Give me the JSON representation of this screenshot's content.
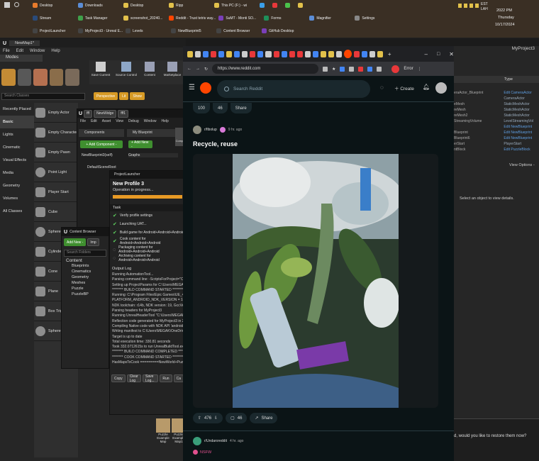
{
  "taskbar": {
    "row1": [
      "Desktop",
      "Downloads",
      "Desktop",
      "Ripp",
      "This PC (F:) - wi",
      "",
      "",
      "",
      ""
    ],
    "row2": [
      "Stream",
      "Task Manager",
      "screenshot_20240...",
      "Reddit - Trust tetris way...",
      "SuMT - Monti SO...",
      "Forms",
      "Magnifier",
      "Settings"
    ],
    "row3": [
      "ProjectLauncher",
      "MyProject3 - Unreal E...",
      "Levels",
      "NewBlueprint5",
      "Content Browser",
      "GitHub Desktop"
    ],
    "time": "2022 PM",
    "day": "Thursday",
    "date": "10/17/2024",
    "tz": "EST",
    "lang": "LAH"
  },
  "ue": {
    "title": "NewMap1*",
    "menu": [
      "File",
      "Edit",
      "Window",
      "Help"
    ],
    "modes_tab": "Modes",
    "search_placeholder": "Search Classes",
    "categories": [
      "Recently Placed",
      "Basic",
      "Lights",
      "Cinematic",
      "Visual Effects",
      "Media",
      "Geometry",
      "Volumes",
      "All Classes"
    ],
    "placeables": [
      "Empty Actor",
      "Empty Character",
      "Empty Pawn",
      "Point Light",
      "Player Start",
      "Cube",
      "Sphere",
      "Cylinder",
      "Cone",
      "Plane",
      "Box Trigger",
      "Sphere Trigger"
    ],
    "toolbar": [
      "Save Current",
      "Source Control",
      "Content",
      "Marketplace"
    ],
    "toolbar2": [
      "Perspective",
      "Lit",
      "Show"
    ],
    "bp_tabs": [
      "fff",
      "NewWidge",
      "fff1"
    ],
    "bp_menu": [
      "File",
      "Edit",
      "Asset",
      "View",
      "Debug",
      "Window",
      "Help"
    ],
    "components_label": "Components",
    "add_component": "+ Add Component -",
    "component_root": "NewBlueprint3(self)",
    "component_scene": "DefaultSceneRoot",
    "myblueprint": "My Blueprint",
    "add_new": "+ Add New -",
    "graphs": "Graphs",
    "compile": "Compile",
    "launcher_tab": "ProjectLauncher",
    "profile": "New Profile 3",
    "operation": "Operation in progress...",
    "task_header": "Task",
    "tasks": [
      "Verify profile settings",
      "Launching UAT...",
      "Build game for Android+Android+Android",
      "Cook content for Android+Android+Android",
      "Packaging content for Android+Android+Android",
      "Archiving content for Android+Android+Android"
    ],
    "output_log": "Output Log",
    "log": [
      "Running AutomationTool...",
      "Parsing command line: -ScriptsForProject=\"C:/U",
      "Setting up ProjectParams for C:\\Users\\MEGAK\\D",
      "******** BUILD COMMAND STARTED ********",
      "Running: C:\\Program Files\\Epic Games\\UE_4.2",
      "  PLATFORM_ANDROID_NDK_VERSION = 14020",
      "  NDK toolchain: r14b, NDK version: 19, GccVer",
      "  Parsing headers for MyProject3",
      "  Running UnrealHeaderTool \"C:\\Users\\MEGAK\\",
      "  Reflection code generated for MyProject3 in 2",
      "  Compiling Native code with NDK API 'android-",
      "  Writing manifest to C:\\Users\\MEGAK\\OneDriv",
      "  Target is up to date",
      "  Total execution time: 330.81 seconds",
      "Took 332.0712615s to run UnrealBuildTool.exe",
      "******** BUILD COMMAND COMPLETED ********",
      "******** COOK COMMAND STARTED ********",
      "HasMapsToCook =========NewWorld+PuzzleE"
    ],
    "log_buttons": [
      "Copy",
      "Clear Log",
      "Save Log...",
      "Run",
      "Ca"
    ],
    "cb_tab": "Content Browser",
    "cb_add": "Add New -",
    "cb_import": "Imp",
    "cb_search": "Search Folders",
    "folders": [
      "Content",
      "Blueprints",
      "Cinematics",
      "Geometry",
      "Meshes",
      "Puzzle",
      "PuzzleBP"
    ],
    "cb_assets": [
      "Puzzle Example Map",
      "Puzzle Example Map1"
    ]
  },
  "browser": {
    "url": "https://www.reddit.com",
    "error_label": "Error",
    "search_placeholder": "Search Reddit",
    "create": "Create",
    "prev_votes": "100",
    "prev_comments": "46",
    "prev_share": "Share",
    "author": "r/fibolup",
    "age": "9 hr. ago",
    "title": "Recycle, reuse",
    "votes": "476",
    "comments": "46",
    "share": "Share",
    "next_author": "r/Undaroreddit",
    "next_age": "4 hr. ago",
    "nsfw": "NSFW"
  },
  "details": {
    "title": "MyProject3",
    "type_header": "Type",
    "rows": [
      [
        "eraActor_Blueprint",
        "Edit CameraActor"
      ],
      [
        "",
        "CameraActor"
      ],
      [
        "eMesh",
        "StaticMeshActor"
      ],
      [
        "reMesh",
        "StaticMeshActor"
      ],
      [
        "reMesh2",
        "StaticMeshActor"
      ],
      [
        "StreamingVolume",
        "LevelStreamingVol"
      ],
      [
        "",
        "Edit NewBlueprint"
      ],
      [
        "Blueprint",
        "Edit NewBlueprint"
      ],
      [
        "Blueprint6",
        "Edit NewBlueprint"
      ],
      [
        "erStart",
        "PlayerStart"
      ],
      [
        "ntBlock",
        "Edit PuzzleBlock"
      ]
    ],
    "view_options": "View Options -",
    "select_prompt": "Select an object to view details.",
    "restore_prompt": "d, would you like to restore them now?"
  }
}
